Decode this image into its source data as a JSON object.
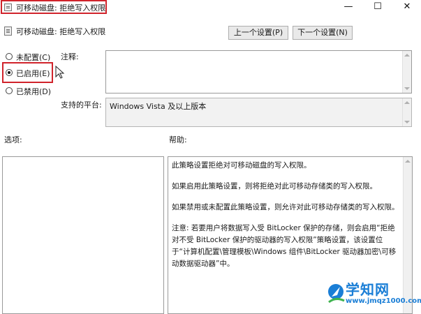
{
  "window": {
    "title": "可移动磁盘: 拒绝写入权限",
    "minimize_glyph": "—",
    "maximize_glyph": "☐",
    "close_glyph": "✕"
  },
  "header": {
    "policy_name": "可移动磁盘: 拒绝写入权限",
    "prev_button": "上一个设置(P)",
    "next_button": "下一个设置(N)"
  },
  "state": {
    "options": [
      {
        "label": "未配置(C)",
        "selected": false
      },
      {
        "label": "已启用(E)",
        "selected": true
      },
      {
        "label": "已禁用(D)",
        "selected": false
      }
    ]
  },
  "comment": {
    "label": "注释:",
    "value": ""
  },
  "platform": {
    "label": "支持的平台:",
    "value": "Windows Vista 及以上版本"
  },
  "options_section": {
    "label": "选项:"
  },
  "help_section": {
    "label": "帮助:",
    "paragraphs": [
      "此策略设置拒绝对可移动磁盘的写入权限。",
      "如果启用此策略设置，则将拒绝对此可移动存储类的写入权限。",
      "如果禁用或未配置此策略设置，则允许对此可移动存储类的写入权限。",
      "注意: 若要用户将数据写入受 BitLocker 保护的存储，则会启用“拒绝对不受 BitLocker 保护的驱动器的写入权限”策略设置，该设置位于“计算机配置\\管理模板\\Windows 组件\\BitLocker 驱动器加密\\可移动数据驱动器”中。"
    ]
  },
  "watermark": {
    "name": "学知网",
    "url": "www.jmqz1000.com"
  },
  "colors": {
    "highlight": "#d0232b",
    "watermark": "#1a7ed6"
  }
}
